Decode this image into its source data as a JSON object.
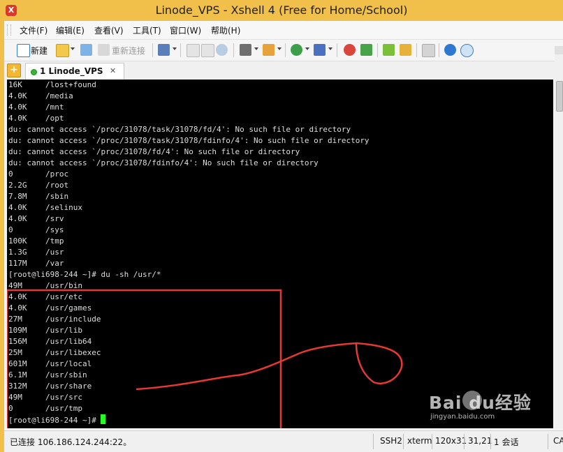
{
  "window": {
    "title": "Linode_VPS - Xshell 4 (Free for Home/School)"
  },
  "menu": [
    "文件(F)",
    "编辑(E)",
    "查看(V)",
    "工具(T)",
    "窗口(W)",
    "帮助(H)"
  ],
  "toolbar": {
    "new_label": "新建",
    "reconnect_label": "重新连接"
  },
  "tabs": [
    {
      "index": "1",
      "label": "Linode_VPS",
      "close": "✕",
      "status_color": "#35b535"
    }
  ],
  "terminal": {
    "lines": [
      "16K     /lost+found",
      "4.0K    /media",
      "4.0K    /mnt",
      "4.0K    /opt",
      "du: cannot access `/proc/31078/task/31078/fd/4': No such file or directory",
      "du: cannot access `/proc/31078/task/31078/fdinfo/4': No such file or directory",
      "du: cannot access `/proc/31078/fd/4': No such file or directory",
      "du: cannot access `/proc/31078/fdinfo/4': No such file or directory",
      "0       /proc",
      "2.2G    /root",
      "7.8M    /sbin",
      "4.0K    /selinux",
      "4.0K    /srv",
      "0       /sys",
      "100K    /tmp",
      "1.3G    /usr",
      "117M    /var",
      "[root@li698-244 ~]# du -sh /usr/*",
      "49M     /usr/bin",
      "4.0K    /usr/etc",
      "4.0K    /usr/games",
      "27M     /usr/include",
      "109M    /usr/lib",
      "156M    /usr/lib64",
      "25M     /usr/libexec",
      "601M    /usr/local",
      "6.1M    /usr/sbin",
      "312M    /usr/share",
      "49M     /usr/src",
      "0       /usr/tmp"
    ],
    "prompt": "[root@li698-244 ~]# ",
    "background": "#000000",
    "foreground": "#dedede",
    "cursor_color": "#23ff23",
    "annotation_color": "#e53935"
  },
  "status": {
    "connection": "已连接 106.186.124.244:22。",
    "protocol": "SSH2",
    "term": "xterm",
    "size": "120x31",
    "position": "31,21",
    "sessions": "1 会话",
    "caps": "CA"
  },
  "watermark": {
    "brand": "Bai  du",
    "suffix": "经验",
    "url": "jingyan.baidu.com"
  }
}
